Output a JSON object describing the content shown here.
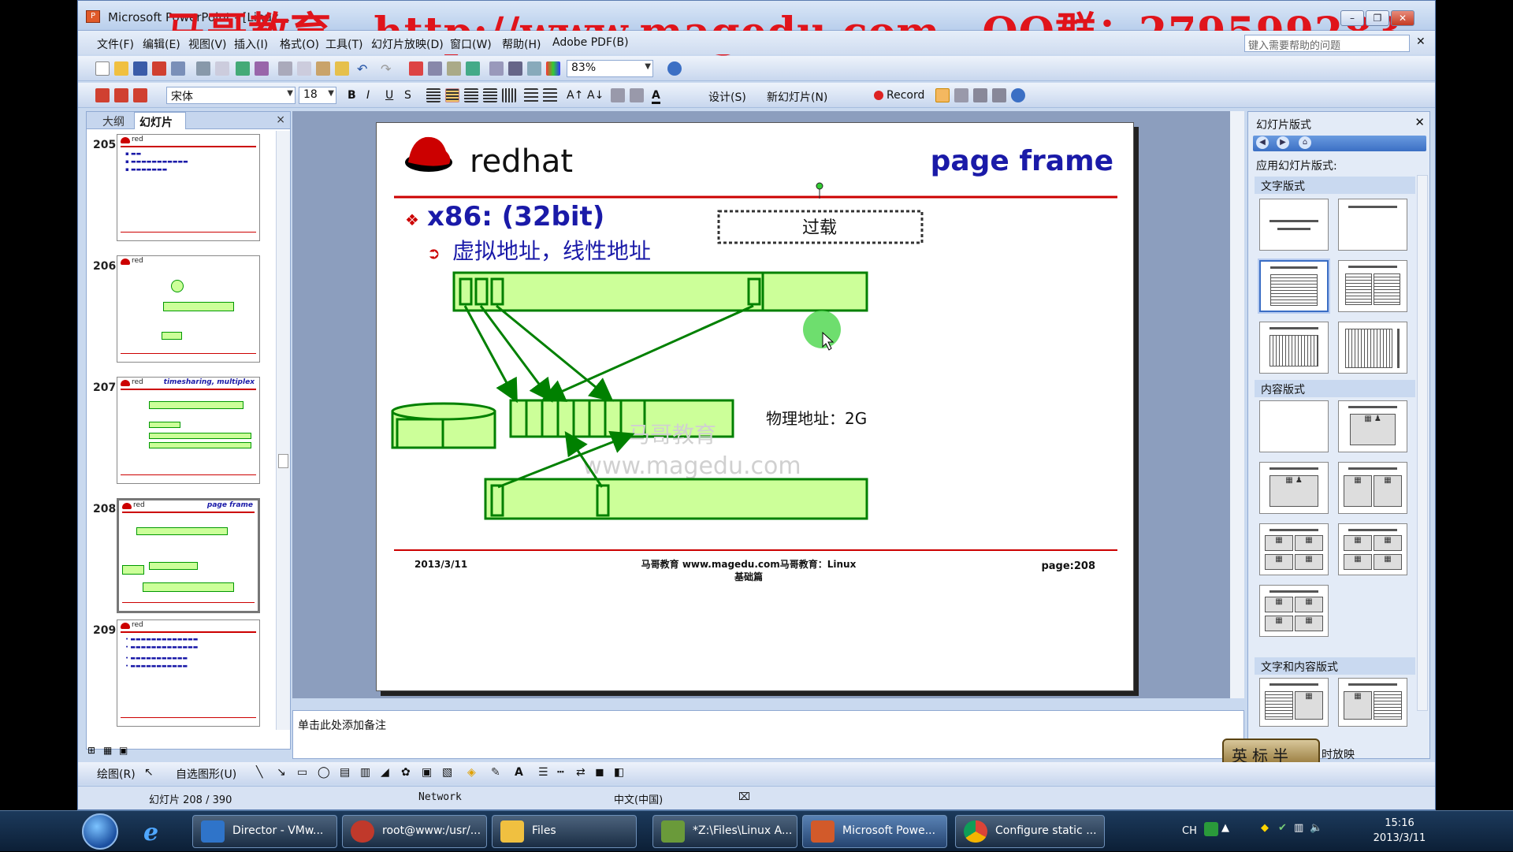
{
  "window": {
    "app_title": "Microsoft PowerPoint - [Linux...",
    "banner": "马哥教育，http://www.magedu.com，QQ群：279599283",
    "help_placeholder": "键入需要帮助的问题"
  },
  "menus": [
    "文件(F)",
    "编辑(E)",
    "视图(V)",
    "插入(I)",
    "格式(O)",
    "工具(T)",
    "幻灯片放映(D)",
    "窗口(W)",
    "帮助(H)",
    "Adobe PDF(B)"
  ],
  "toolbar1": {
    "zoom": "83%"
  },
  "toolbar2": {
    "font": "宋体",
    "size": "18",
    "design": "设计(S)",
    "new_slide": "新幻灯片(N)",
    "record": "Record"
  },
  "left_pane": {
    "tab_outline": "大纲",
    "tab_slides": "幻灯片",
    "close": "×"
  },
  "thumbnails": [
    {
      "num": "205",
      "header": ""
    },
    {
      "num": "206",
      "header": ""
    },
    {
      "num": "207",
      "header": "timesharing, multiplex"
    },
    {
      "num": "208",
      "header": "page frame"
    },
    {
      "num": "209",
      "header": ""
    }
  ],
  "slide": {
    "logo_text": "redhat",
    "title": "page frame",
    "bullet1": "x86: (32bit)",
    "bullet2": "虚拟地址，线性地址",
    "callout": "过载",
    "phys_label": "物理地址：2G",
    "watermark1": "马哥教育",
    "watermark2": "www.magedu.com",
    "footer_date": "2013/3/11",
    "footer_center1": "马哥教育 www.magedu.com马哥教育：Linux",
    "footer_center2": "基础篇",
    "footer_page": "page:208"
  },
  "notes": {
    "placeholder": "单击此处添加备注"
  },
  "task_pane": {
    "title": "幻灯片版式",
    "apply": "应用幻灯片版式:",
    "sec_text": "文字版式",
    "sec_content": "内容版式",
    "sec_text_content": "文字和内容版式",
    "footer_badge": "英标半",
    "footer_text": "时放映"
  },
  "drawbar": {
    "draw": "绘图(R)",
    "autoshapes": "自选图形(U)"
  },
  "status": {
    "slide": "幻灯片 208 / 390",
    "design": "Network",
    "lang": "中文(中国)"
  },
  "taskbar": {
    "tasks": [
      "Director - VMw...",
      "root@www:/usr/...",
      "Files",
      "*Z:\\Files\\Linux A...",
      "Microsoft Powe...",
      "Configure static ..."
    ],
    "tray_lang": "CH",
    "time": "15:16",
    "date": "2013/3/11"
  },
  "colors": {
    "accent_red": "#cc0000",
    "green_fill": "#ccff99",
    "green_line": "#008000",
    "title_blue": "#1a1aa8"
  }
}
